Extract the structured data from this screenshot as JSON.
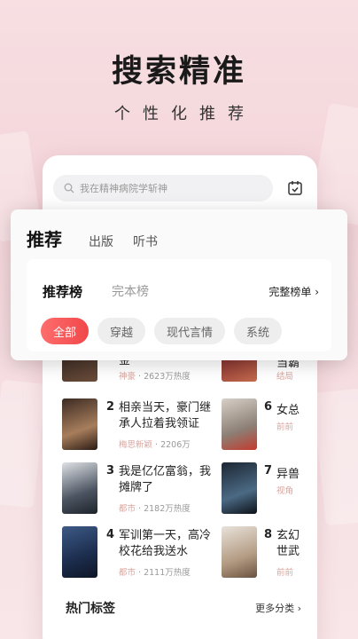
{
  "hero": {
    "title": "搜索精准",
    "subtitle": "个性化推荐"
  },
  "search": {
    "placeholder": "我在精神病院学斩神"
  },
  "tabs": [
    {
      "label": "推荐"
    },
    {
      "label": "出版"
    },
    {
      "label": "听书"
    }
  ],
  "ranking": {
    "active": "推荐榜",
    "other": "完本榜",
    "full": "完整榜单"
  },
  "chips": [
    "全部",
    "穿越",
    "现代言情",
    "系统"
  ],
  "partial_top": {
    "title": "金",
    "category": "神豪",
    "heat": "2623万热度"
  },
  "books_left": [
    {
      "rank": "2",
      "title": "相亲当天，豪门继承人拉着我领证",
      "category": "梅思新颖",
      "heat": "2206万"
    },
    {
      "rank": "3",
      "title": "我是亿亿富翁，我摊牌了",
      "category": "都市",
      "heat": "2182万热度"
    },
    {
      "rank": "4",
      "title": "军训第一天，高冷校花给我送水",
      "category": "都市",
      "heat": "2111万热度"
    }
  ],
  "books_right": [
    {
      "rank": "6",
      "title": "女总",
      "meta": "前前"
    },
    {
      "rank": "7",
      "title": "异兽",
      "meta": "视角"
    },
    {
      "rank": "8",
      "title": "玄幻 世武",
      "meta": "前前"
    }
  ],
  "partial_right": {
    "title": "当霸",
    "meta": "结局"
  },
  "section": {
    "hot_tags": "热门标签",
    "more": "更多分类"
  }
}
